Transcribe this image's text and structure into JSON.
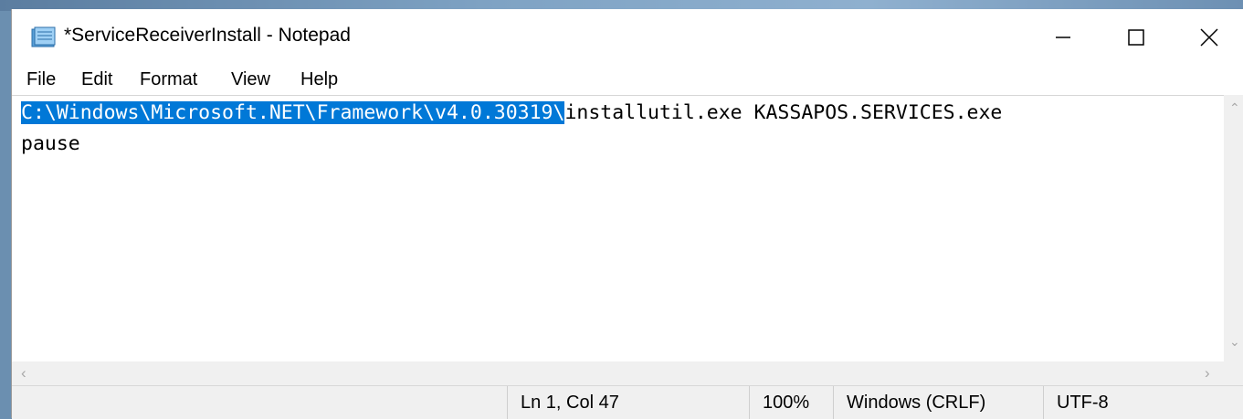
{
  "window": {
    "title": "*ServiceReceiverInstall - Notepad",
    "icon": "notepad-icon",
    "controls": {
      "minimize": "minimize-icon",
      "maximize": "maximize-icon",
      "close": "close-icon"
    }
  },
  "menu": {
    "items": [
      "File",
      "Edit",
      "Format",
      "View",
      "Help"
    ]
  },
  "editor": {
    "line1_selected": "C:\\Windows\\Microsoft.NET\\Framework\\v4.0.30319\\",
    "line1_rest": "installutil.exe KASSAPOS.SERVICES.exe",
    "line2": "pause",
    "selection_color": "#0078d7"
  },
  "status": {
    "position": "Ln 1, Col 47",
    "zoom": "100%",
    "line_ending": "Windows (CRLF)",
    "encoding": "UTF-8"
  }
}
